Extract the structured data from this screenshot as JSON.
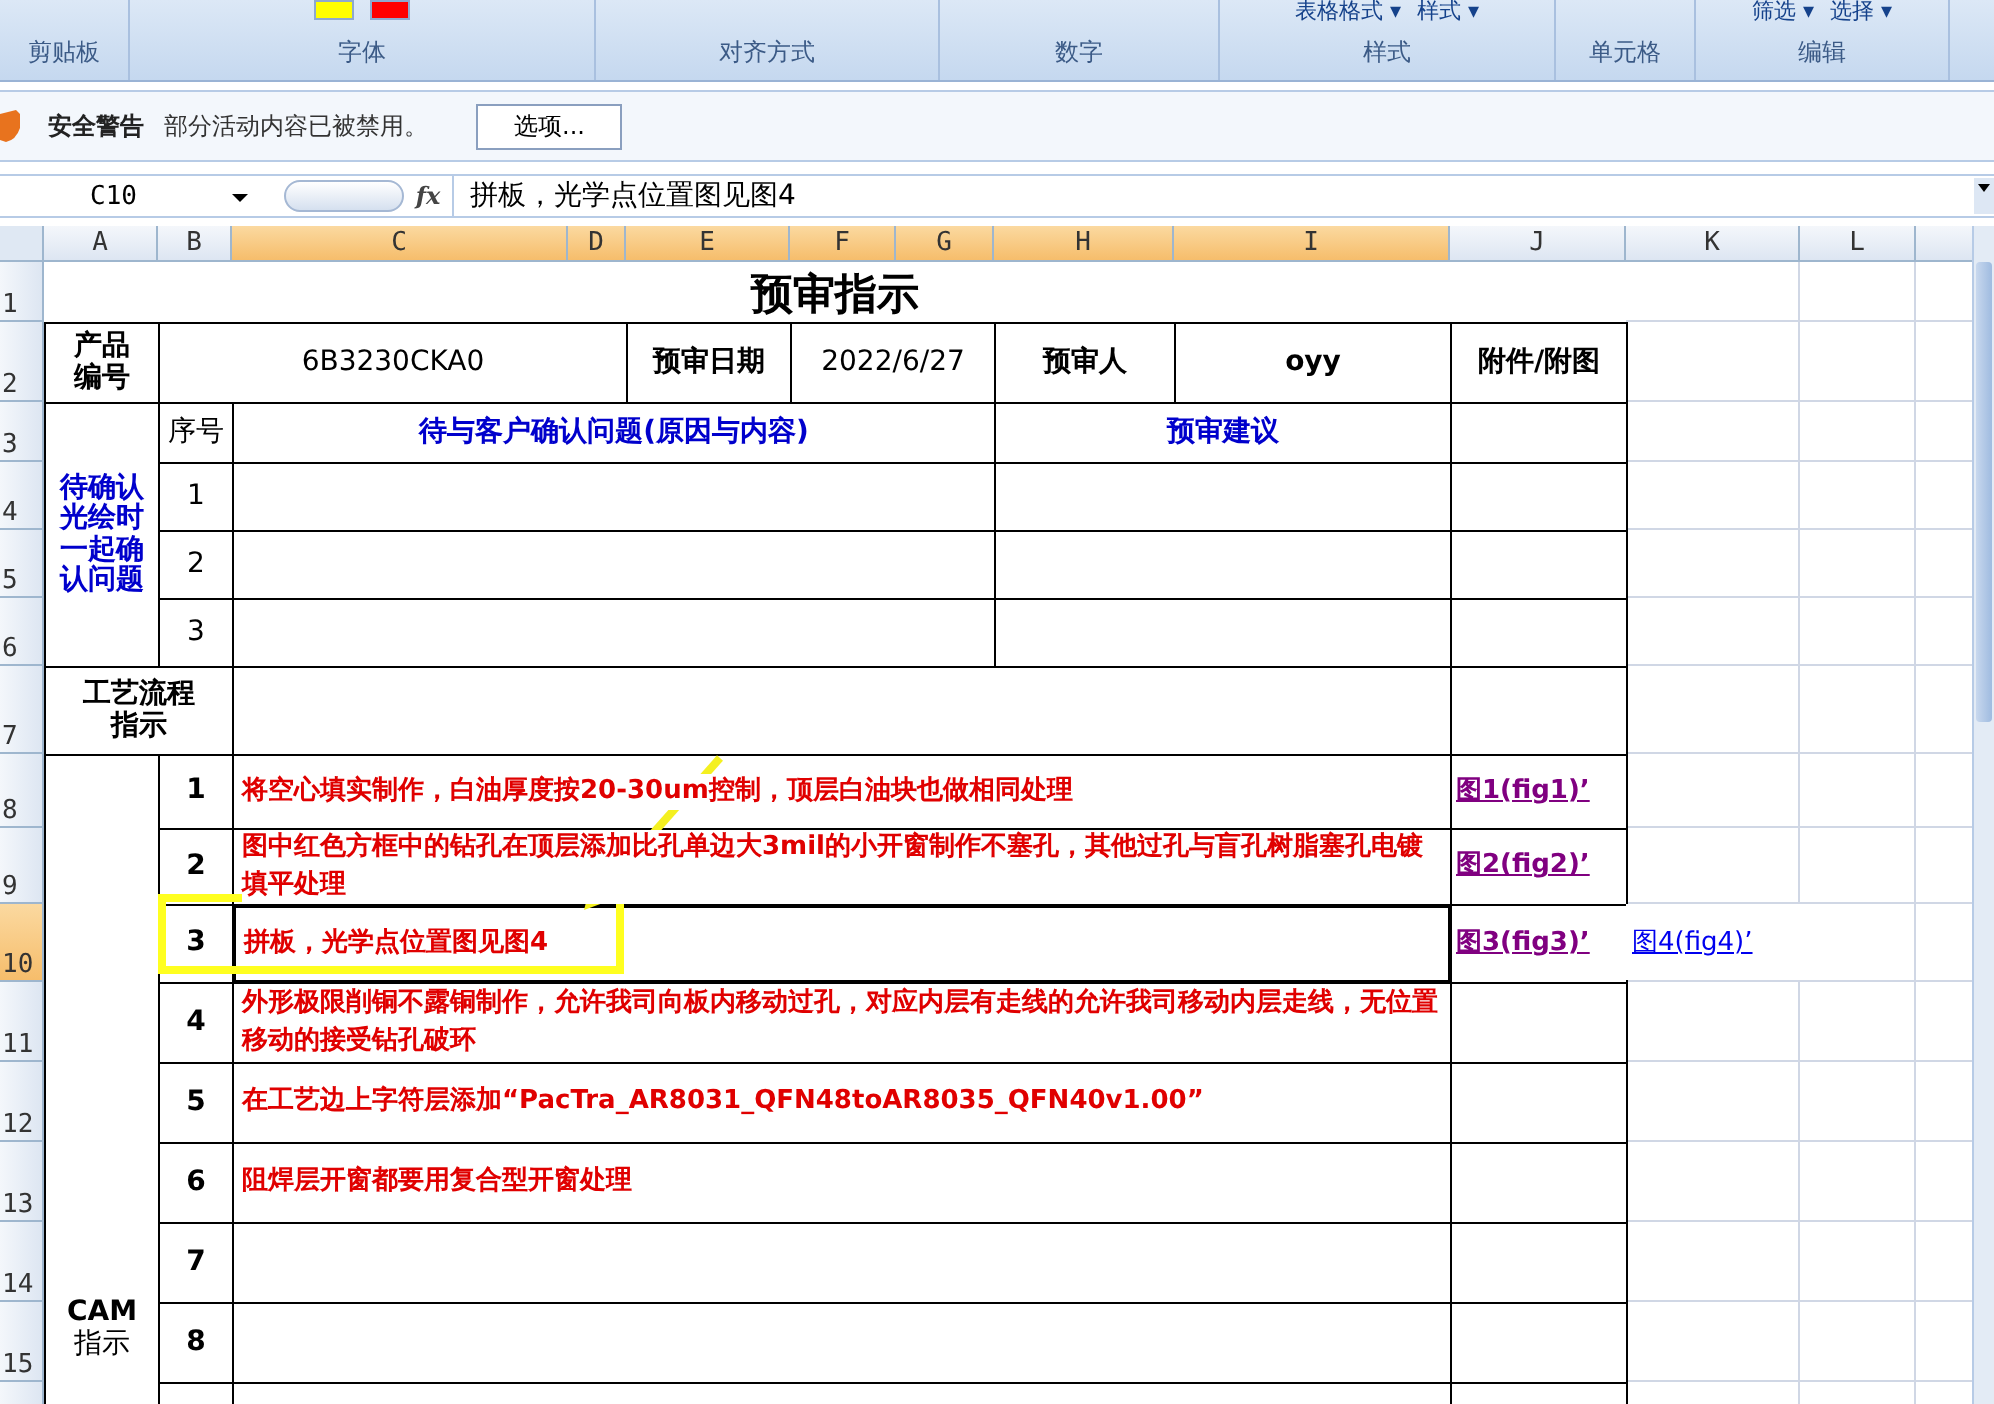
{
  "ribbon": {
    "groups": [
      {
        "label": "剪贴板"
      },
      {
        "label": "字体"
      },
      {
        "label": "对齐方式"
      },
      {
        "label": "数字"
      },
      {
        "label": "样式",
        "top_labels": [
          "表格格式 ▾",
          "样式 ▾"
        ]
      },
      {
        "label": "单元格"
      },
      {
        "label": "编辑",
        "top_labels": [
          "筛选 ▾",
          "选择 ▾"
        ]
      }
    ]
  },
  "security_bar": {
    "title": "安全警告",
    "message": "部分活动内容已被禁用。",
    "button": "选项..."
  },
  "formula_bar": {
    "name_box": "C10",
    "fx": "fx",
    "content": "拼板，光学点位置图见图4"
  },
  "sheet": {
    "columns": [
      {
        "label": "A",
        "selected": false
      },
      {
        "label": "B",
        "selected": false
      },
      {
        "label": "C",
        "selected": true
      },
      {
        "label": "D",
        "selected": true
      },
      {
        "label": "E",
        "selected": true
      },
      {
        "label": "F",
        "selected": true
      },
      {
        "label": "G",
        "selected": true
      },
      {
        "label": "H",
        "selected": true
      },
      {
        "label": "I",
        "selected": true
      },
      {
        "label": "J",
        "selected": false
      },
      {
        "label": "K",
        "selected": false
      },
      {
        "label": "L",
        "selected": false
      }
    ],
    "row_numbers": [
      {
        "label": "1",
        "selected": false
      },
      {
        "label": "2",
        "selected": false
      },
      {
        "label": "3",
        "selected": false
      },
      {
        "label": "4",
        "selected": false
      },
      {
        "label": "5",
        "selected": false
      },
      {
        "label": "6",
        "selected": false
      },
      {
        "label": "7",
        "selected": false
      },
      {
        "label": "8",
        "selected": false
      },
      {
        "label": "9",
        "selected": false
      },
      {
        "label": "10",
        "selected": true
      },
      {
        "label": "11",
        "selected": false
      },
      {
        "label": "12",
        "selected": false
      },
      {
        "label": "13",
        "selected": false
      },
      {
        "label": "14",
        "selected": false
      },
      {
        "label": "15",
        "selected": false
      }
    ],
    "title": "预审指示",
    "header": {
      "product_label": "产品编号",
      "product_code": "6B3230CKA0",
      "date_label": "预审日期",
      "date": "2022/6/27",
      "reviewer_label": "预审人",
      "reviewer": "oyy",
      "attachment_label": "附件/附图"
    },
    "confirm": {
      "label": "待确认光绘时一起确认问题",
      "seq_header": "序号",
      "issue_header": "待与客户确认问题(原因与内容)",
      "advice_header": "预审建议",
      "rows": [
        {
          "seq": "1"
        },
        {
          "seq": "2"
        },
        {
          "seq": "3"
        }
      ]
    },
    "process": {
      "label": "工艺流程指示"
    },
    "cam": {
      "label_top": "CAM",
      "label_bottom": "指示",
      "rows": [
        {
          "seq": "1",
          "selected": false,
          "text": "将空心填实制作，白油厚度按20-30um控制，顶层白油块也做相同处理",
          "links": [
            {
              "label": "图1(fig1)’",
              "visited": true
            }
          ]
        },
        {
          "seq": "2",
          "selected": false,
          "text": "图中红色方框中的钻孔在顶层添加比孔单边大3mil的小开窗制作不塞孔，其他过孔与盲孔树脂塞孔电镀填平处理",
          "links": [
            {
              "label": "图2(fig2)’",
              "visited": true
            }
          ]
        },
        {
          "seq": "3",
          "selected": true,
          "text": "拼板，光学点位置图见图4",
          "links": [
            {
              "label": "图3(fig3)’",
              "visited": true
            },
            {
              "label": "图4(fig4)’",
              "visited": false
            }
          ]
        },
        {
          "seq": "4",
          "selected": false,
          "text": "外形极限削铜不露铜制作，允许我司向板内移动过孔，对应内层有走线的允许我司移动内层走线，无位置移动的接受钻孔破环",
          "links": []
        },
        {
          "seq": "5",
          "selected": false,
          "text": "在工艺边上字符层添加“PacTra_AR8031_QFN48toAR8035_QFN40v1.00”",
          "links": []
        },
        {
          "seq": "6",
          "selected": false,
          "text": "阻焊层开窗都要用复合型开窗处理",
          "links": []
        },
        {
          "seq": "7",
          "selected": false,
          "links": []
        },
        {
          "seq": "8",
          "selected": false,
          "links": []
        }
      ]
    }
  }
}
